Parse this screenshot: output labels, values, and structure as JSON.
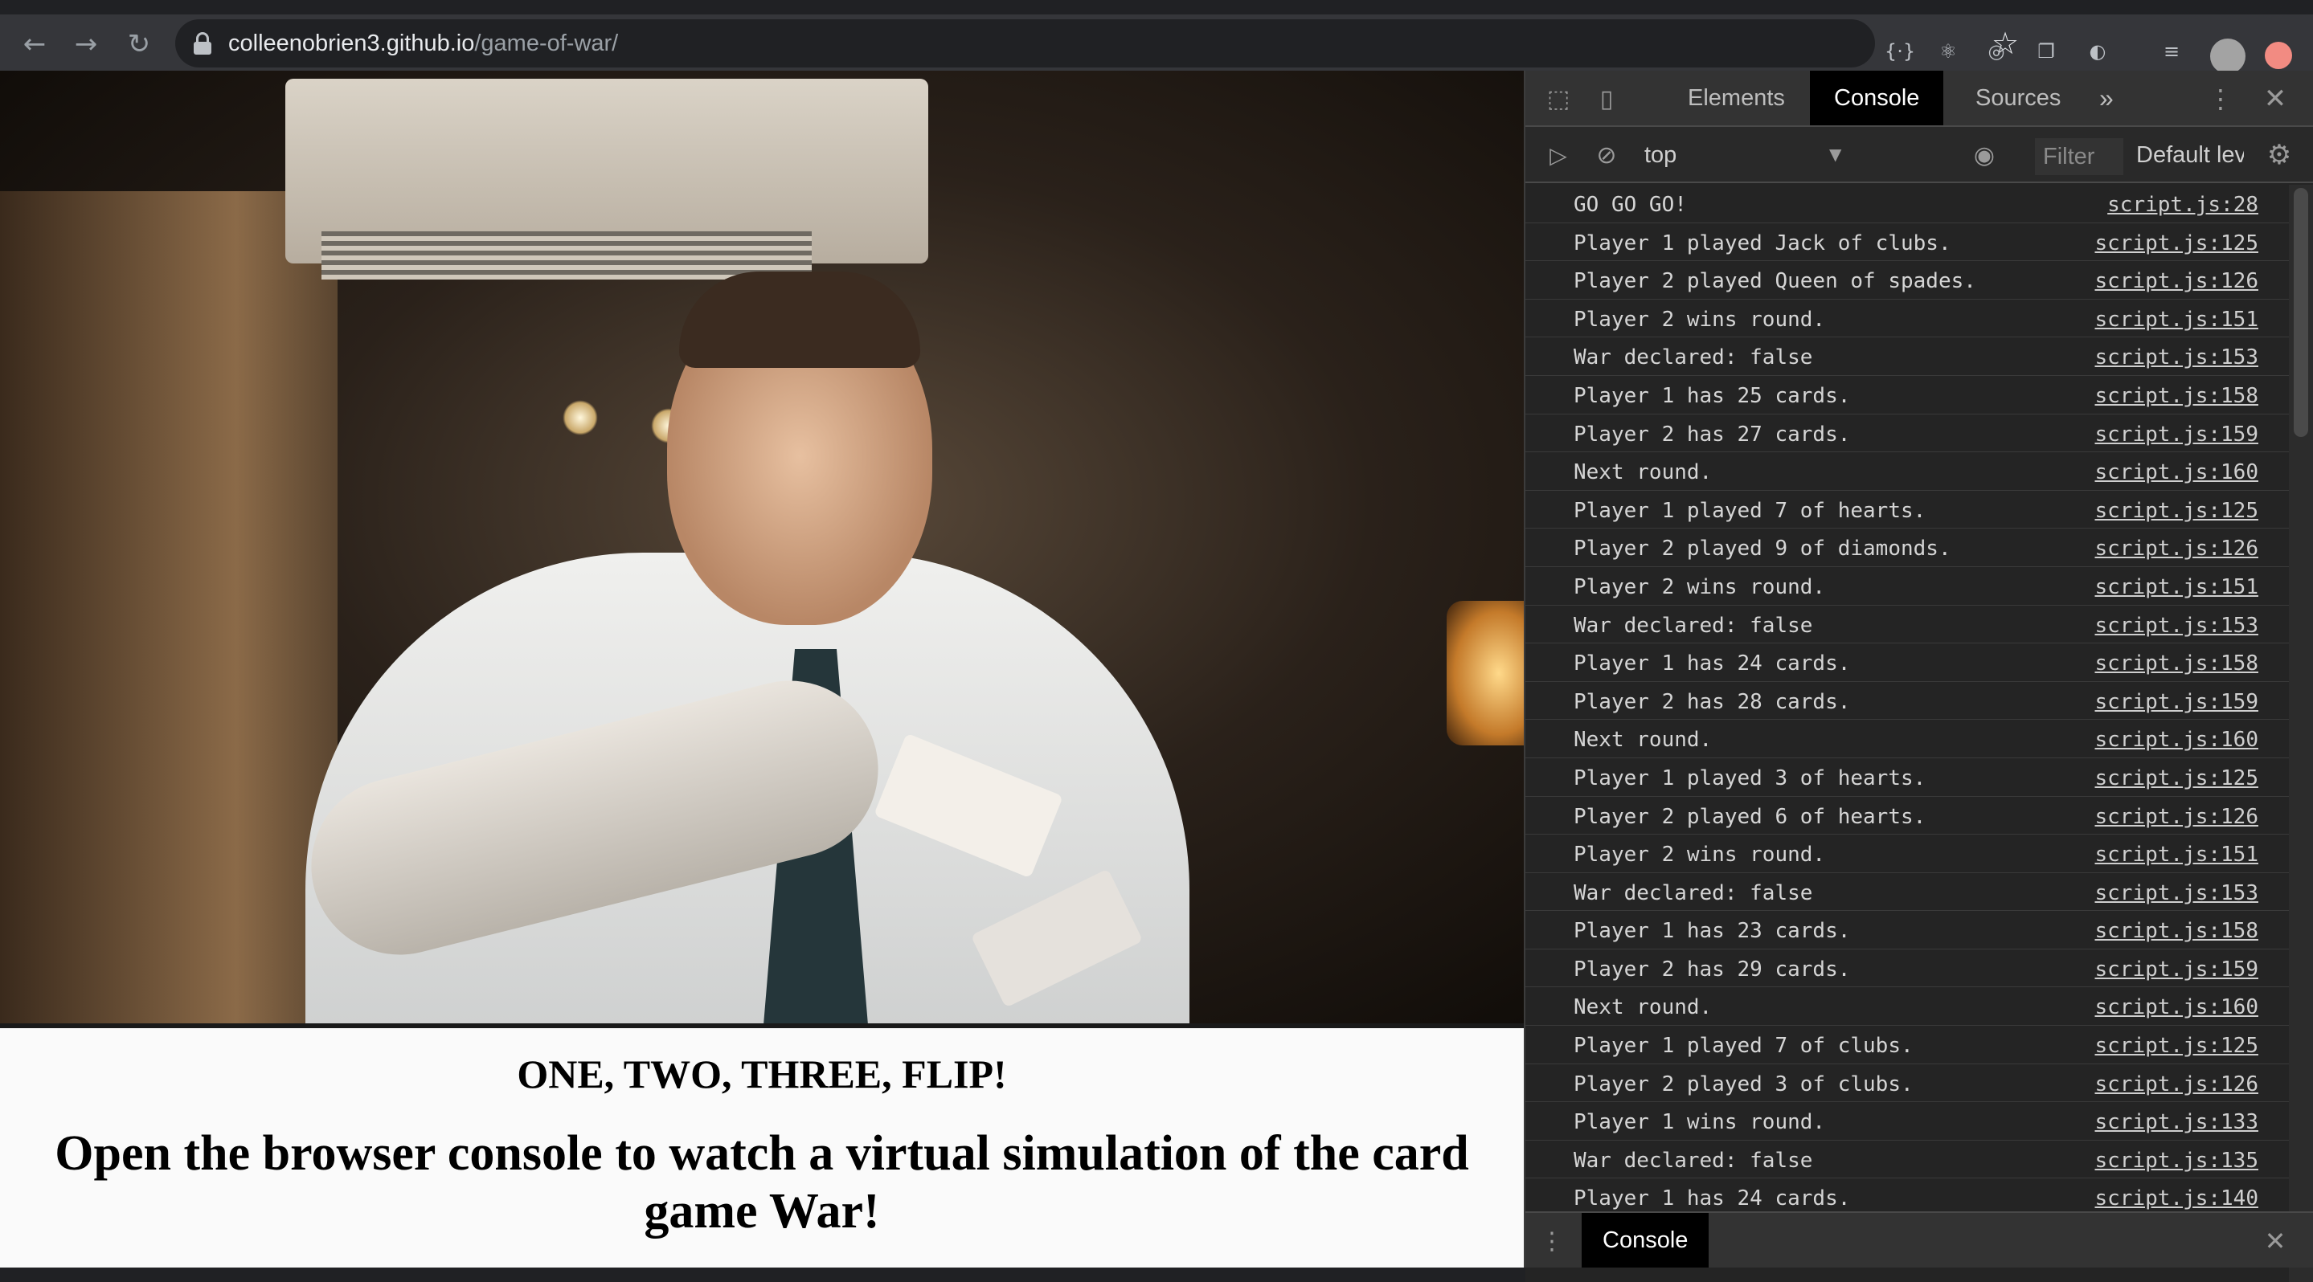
{
  "browser": {
    "url_host": "colleenobrien3.github.io",
    "url_path": "/game-of-war/",
    "icons": [
      "back-icon",
      "forward-icon",
      "reload-icon",
      "lock-icon",
      "star-icon",
      "extension-icons",
      "avatar"
    ]
  },
  "page": {
    "headline": "ONE, TWO, THREE, FLIP!",
    "subheadline": "Open the browser console to watch a virtual simulation of the card game War!"
  },
  "devtools": {
    "tabs": [
      {
        "label": "Elements",
        "active": false
      },
      {
        "label": "Console",
        "active": true
      },
      {
        "label": "Sources",
        "active": false
      }
    ],
    "more_tabs": "»",
    "context": "top",
    "filter_placeholder": "Filter",
    "level": "Default lev",
    "drawer_tab": "Console",
    "log": [
      {
        "msg": "GO GO GO!",
        "src": "script.js:28"
      },
      {
        "msg": "Player 1 played Jack of clubs.",
        "src": "script.js:125"
      },
      {
        "msg": "Player 2 played Queen of spades.",
        "src": "script.js:126"
      },
      {
        "msg": "Player 2 wins round.",
        "src": "script.js:151"
      },
      {
        "msg": "War declared: false",
        "src": "script.js:153"
      },
      {
        "msg": "Player 1 has 25 cards.",
        "src": "script.js:158"
      },
      {
        "msg": "Player 2 has 27 cards.",
        "src": "script.js:159"
      },
      {
        "msg": "Next round.",
        "src": "script.js:160"
      },
      {
        "msg": "Player 1 played 7 of hearts.",
        "src": "script.js:125"
      },
      {
        "msg": "Player 2 played 9 of diamonds.",
        "src": "script.js:126"
      },
      {
        "msg": "Player 2 wins round.",
        "src": "script.js:151"
      },
      {
        "msg": "War declared: false",
        "src": "script.js:153"
      },
      {
        "msg": "Player 1 has 24 cards.",
        "src": "script.js:158"
      },
      {
        "msg": "Player 2 has 28 cards.",
        "src": "script.js:159"
      },
      {
        "msg": "Next round.",
        "src": "script.js:160"
      },
      {
        "msg": "Player 1 played 3 of hearts.",
        "src": "script.js:125"
      },
      {
        "msg": "Player 2 played 6 of hearts.",
        "src": "script.js:126"
      },
      {
        "msg": "Player 2 wins round.",
        "src": "script.js:151"
      },
      {
        "msg": "War declared: false",
        "src": "script.js:153"
      },
      {
        "msg": "Player 1 has 23 cards.",
        "src": "script.js:158"
      },
      {
        "msg": "Player 2 has 29 cards.",
        "src": "script.js:159"
      },
      {
        "msg": "Next round.",
        "src": "script.js:160"
      },
      {
        "msg": "Player 1 played 7 of clubs.",
        "src": "script.js:125"
      },
      {
        "msg": "Player 2 played 3 of clubs.",
        "src": "script.js:126"
      },
      {
        "msg": "Player 1 wins round.",
        "src": "script.js:133"
      },
      {
        "msg": "War declared: false",
        "src": "script.js:135"
      },
      {
        "msg": "Player 1 has 24 cards.",
        "src": "script.js:140"
      }
    ]
  }
}
